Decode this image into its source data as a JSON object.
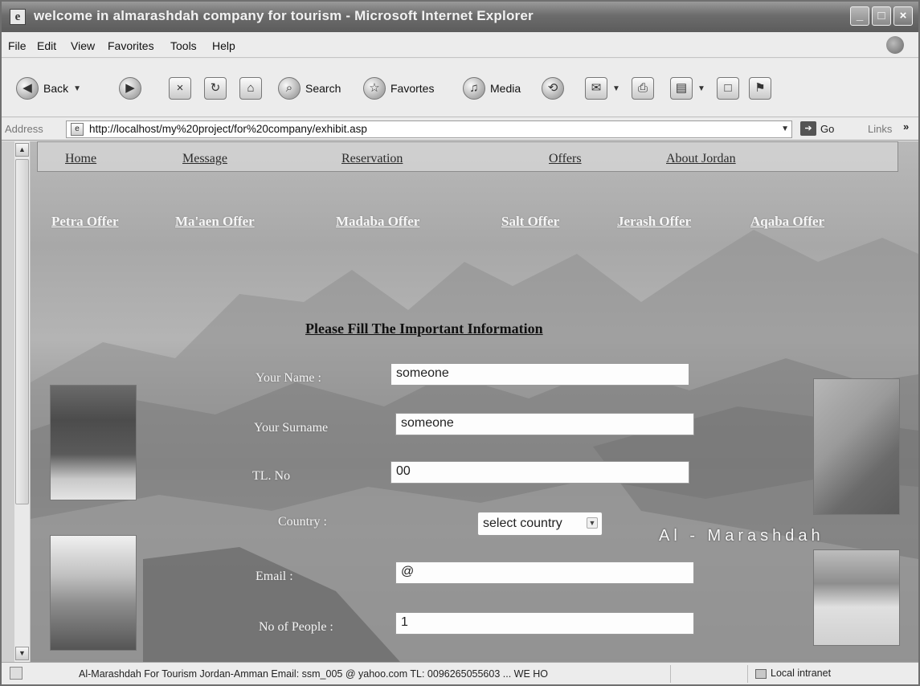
{
  "window": {
    "title": "welcome in almarashdah company for tourism - Microsoft Internet Explorer",
    "icon": "ie-page-icon",
    "controls": [
      "minimize",
      "maximize",
      "close"
    ]
  },
  "menu": [
    "File",
    "Edit",
    "View",
    "Favorites",
    "Tools",
    "Help"
  ],
  "toolbar": {
    "back": "Back",
    "search": "Search",
    "favorites": "Favortes",
    "media": "Media"
  },
  "address": {
    "label": "Address",
    "url": "http://localhost/my%20project/for%20company/exhibit.asp",
    "go": "Go",
    "links": "Links",
    "more": "»"
  },
  "page": {
    "nav": [
      "Home",
      "Message",
      "Reservation",
      "Offers",
      "About Jordan"
    ],
    "offers": [
      "Petra Offer",
      "Ma'aen Offer",
      "Madaba Offer",
      "Salt Offer",
      "Jerash Offer",
      "Aqaba Offer"
    ],
    "form": {
      "title": "Please Fill The Important Information",
      "name_label": "Your Name :",
      "name_value": "someone",
      "surname_label": "Your Surname",
      "surname_value": "someone",
      "tel_label": "TL. No",
      "tel_value": "00",
      "country_label": "Country :",
      "country_value": "select country",
      "email_label": "Email :",
      "email_value": "@",
      "people_label": "No of People :",
      "people_value": "1"
    },
    "brand": "Al - Marashdah"
  },
  "status": {
    "text": "Al-Marashdah For Tourism  Jordan-Amman  Email: ssm_005 @ yahoo.com TL: 0096265055603  ... WE HO",
    "zone": "Local intranet"
  }
}
